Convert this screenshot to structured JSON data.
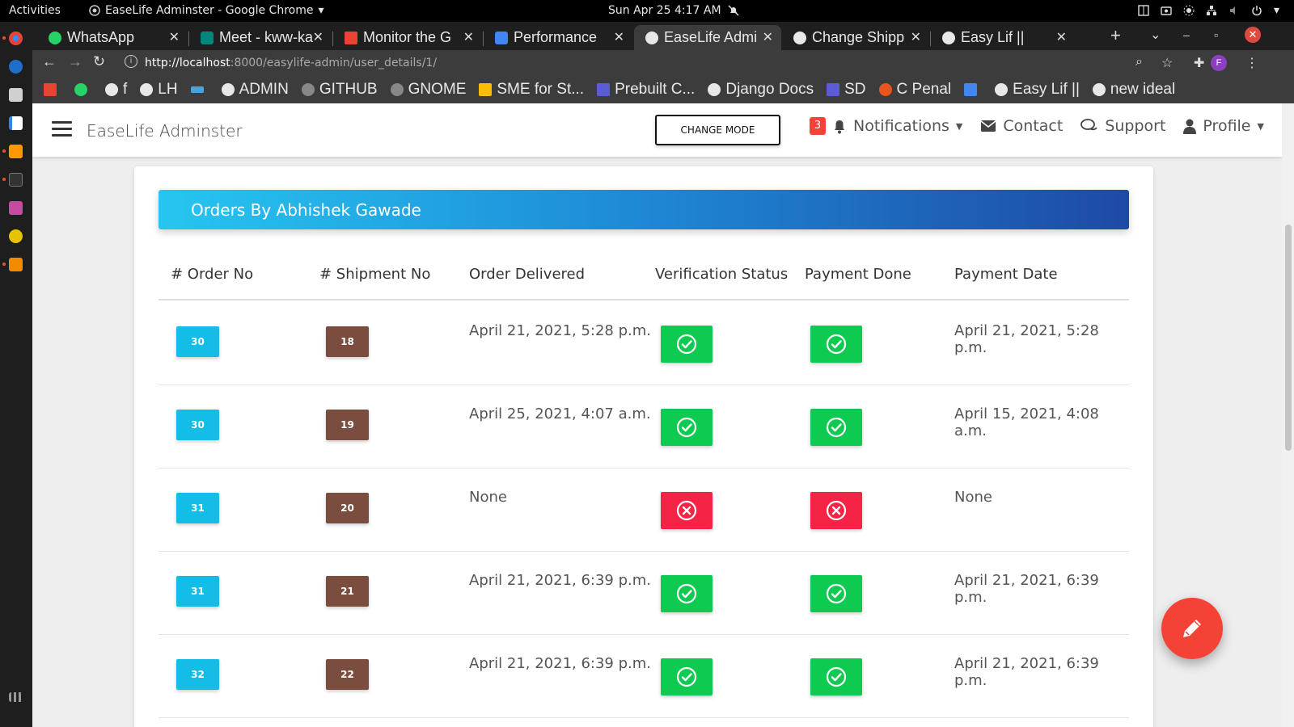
{
  "os": {
    "activities": "Activities",
    "window_title": "EaseLife Adminster - Google Chrome",
    "clock": "Sun Apr 25   4:17 AM"
  },
  "browser": {
    "tabs": [
      {
        "label": "WhatsApp",
        "favicon_color": "#25d366"
      },
      {
        "label": "Meet - kww-ka",
        "favicon_color": "#00897b"
      },
      {
        "label": "Monitor the G",
        "favicon_color": "#ea4335"
      },
      {
        "label": "Performance",
        "favicon_color": "#4285f4"
      },
      {
        "label": "EaseLife Admi",
        "favicon_color": "#e8e8e8"
      },
      {
        "label": "Change Shipp",
        "favicon_color": "#e8e8e8"
      },
      {
        "label": "Easy Lif ||",
        "favicon_color": "#e8e8e8"
      }
    ],
    "new_tab": "+",
    "url_host": "http://localhost",
    "url_path": ":8000/easylife-admin/user_details/1/",
    "profile_initial": "F",
    "bookmarks": [
      {
        "label": "",
        "icon_color": "#ea4335"
      },
      {
        "label": "",
        "icon_color": "#25d366"
      },
      {
        "label": "f",
        "icon_color": "#e8e8e8"
      },
      {
        "label": "LH",
        "icon_color": "#e8e8e8"
      },
      {
        "label": "",
        "icon_color": "#4aa3df"
      },
      {
        "label": "ADMIN",
        "icon_color": "#e8e8e8"
      },
      {
        "label": "GITHUB",
        "icon_color": "#888888"
      },
      {
        "label": "GNOME",
        "icon_color": "#888888"
      },
      {
        "label": "SME for St...",
        "icon_color": "#fbbc04"
      },
      {
        "label": "Prebuilt C...",
        "icon_color": "#5b5bd6"
      },
      {
        "label": "Django Docs",
        "icon_color": "#e8e8e8"
      },
      {
        "label": "SD",
        "icon_color": "#5b5bd6"
      },
      {
        "label": "C Penal",
        "icon_color": "#e95420"
      },
      {
        "label": "",
        "icon_color": "#4285f4"
      },
      {
        "label": "Easy Lif ||",
        "icon_color": "#e8e8e8"
      },
      {
        "label": "new ideal",
        "icon_color": "#e8e8e8"
      }
    ]
  },
  "navbar": {
    "brand": "EaseLife Adminster",
    "change_mode": "CHANGE MODE",
    "notification_count": "3",
    "notifications": "Notifications",
    "contact": "Contact",
    "support": "Support",
    "profile": "Profile"
  },
  "orders": {
    "title": "Orders By Abhishek Gawade",
    "columns": [
      "# Order No",
      "# Shipment No",
      "Order Delivered",
      "Verification Status",
      "Payment Done",
      "Payment Date"
    ],
    "rows": [
      {
        "order_no": "30",
        "shipment_no": "18",
        "delivered": "April 21, 2021, 5:28 p.m.",
        "verified": true,
        "paid": true,
        "payment_date": "April 21, 2021, 5:28 p.m."
      },
      {
        "order_no": "30",
        "shipment_no": "19",
        "delivered": "April 25, 2021, 4:07 a.m.",
        "verified": true,
        "paid": true,
        "payment_date": "April 15, 2021, 4:08 a.m."
      },
      {
        "order_no": "31",
        "shipment_no": "20",
        "delivered": "None",
        "verified": false,
        "paid": false,
        "payment_date": "None"
      },
      {
        "order_no": "31",
        "shipment_no": "21",
        "delivered": "April 21, 2021, 6:39 p.m.",
        "verified": true,
        "paid": true,
        "payment_date": "April 21, 2021, 6:39 p.m."
      },
      {
        "order_no": "32",
        "shipment_no": "22",
        "delivered": "April 21, 2021, 6:39 p.m.",
        "verified": true,
        "paid": true,
        "payment_date": "April 21, 2021, 6:39 p.m."
      }
    ]
  },
  "colors": {
    "order_tag": "#13bde6",
    "shipment_tag": "#7a4d3e",
    "status_ok": "#0fca51",
    "status_bad": "#f52447",
    "fab": "#f44336"
  }
}
